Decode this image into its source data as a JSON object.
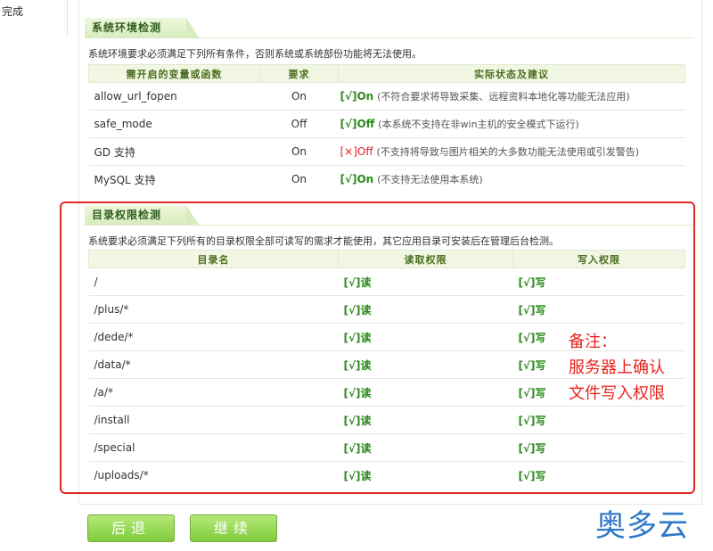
{
  "left_nav": {
    "step_label": "完成"
  },
  "env_section": {
    "title": "系统环境检测",
    "description": "系统环境要求必须满足下列所有条件，否则系统或系统部份功能将无法使用。",
    "headers": [
      "需开启的变量或函数",
      "要求",
      "实际状态及建议"
    ],
    "rows": [
      {
        "name": "allow_url_fopen",
        "required": "On",
        "status_bracket": "[√]",
        "status_value": "On",
        "status_ok": true,
        "note": "(不符合要求将导致采集、远程资料本地化等功能无法应用)"
      },
      {
        "name": "safe_mode",
        "required": "Off",
        "status_bracket": "[√]",
        "status_value": "Off",
        "status_ok": true,
        "note": "(本系统不支持在非win主机的安全模式下运行)"
      },
      {
        "name": "GD 支持",
        "required": "On",
        "status_bracket": "[×]",
        "status_value": "Off",
        "status_ok": false,
        "note": "(不支持将导致与图片相关的大多数功能无法使用或引发警告)"
      },
      {
        "name": "MySQL 支持",
        "required": "On",
        "status_bracket": "[√]",
        "status_value": "On",
        "status_ok": true,
        "note": "(不支持无法使用本系统)"
      }
    ]
  },
  "dir_section": {
    "title": "目录权限检测",
    "description": "系统要求必须满足下列所有的目录权限全部可读写的需求才能使用，其它应用目录可安装后在管理后台检测。",
    "headers": [
      "目录名",
      "读取权限",
      "写入权限"
    ],
    "rows": [
      {
        "dir": "/",
        "read": "[√]读",
        "write": "[√]写"
      },
      {
        "dir": "/plus/*",
        "read": "[√]读",
        "write": "[√]写"
      },
      {
        "dir": "/dede/*",
        "read": "[√]读",
        "write": "[√]写"
      },
      {
        "dir": "/data/*",
        "read": "[√]读",
        "write": "[√]写"
      },
      {
        "dir": "/a/*",
        "read": "[√]读",
        "write": "[√]写"
      },
      {
        "dir": "/install",
        "read": "[√]读",
        "write": "[√]写"
      },
      {
        "dir": "/special",
        "read": "[√]读",
        "write": "[√]写"
      },
      {
        "dir": "/uploads/*",
        "read": "[√]读",
        "write": "[√]写"
      }
    ]
  },
  "annotation": {
    "lines": [
      "备注：",
      "服务器上确认",
      "文件写入权限"
    ],
    "color": "#e8221c"
  },
  "buttons": {
    "back_label": "后退",
    "continue_label": "继续"
  },
  "watermark": {
    "text": "奥多云",
    "color": "#2f79c8"
  },
  "colors": {
    "ok": "#2a8a1a",
    "error": "#e02020",
    "header_bg": "#f1f7e2",
    "button_green": "#7fcb3d",
    "highlight_border": "#e32a21"
  }
}
